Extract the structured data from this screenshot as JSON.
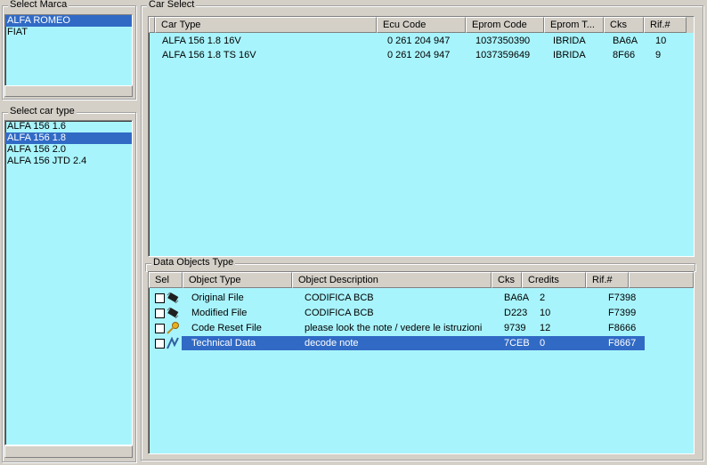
{
  "marca": {
    "title": "Select Marca",
    "items": [
      "ALFA ROMEO",
      "FIAT"
    ],
    "selected": 0
  },
  "cartype": {
    "title": "Select car type",
    "items": [
      "ALFA 156 1.6",
      "ALFA 156 1.8",
      "ALFA 156 2.0",
      "ALFA 156 JTD 2.4"
    ],
    "selected": 1
  },
  "carselect": {
    "title": "Car Select",
    "headers": [
      "Car Type",
      "Ecu Code",
      "Eprom Code",
      "Eprom T...",
      "Cks",
      "Rif.#"
    ],
    "rows": [
      [
        "ALFA 156 1.8 16V",
        "0 261 204 947",
        "1037350390",
        "IBRIDA",
        "BA6A",
        "10"
      ],
      [
        "ALFA 156 1.8 TS 16V",
        "0 261 204 947",
        "1037359649",
        "IBRIDA",
        "8F66",
        "9"
      ]
    ]
  },
  "objects": {
    "title": "Data Objects Type",
    "headers": [
      "Sel",
      "Object Type",
      "Object Description",
      "Cks",
      "Credits",
      "Rif.#"
    ],
    "rows": [
      {
        "icon": "chip-icon",
        "type": "Original File",
        "desc": "CODIFICA BCB",
        "cks": "BA6A",
        "credits": "2",
        "rif": "F7398"
      },
      {
        "icon": "chip-icon",
        "type": "Modified File",
        "desc": "CODIFICA BCB",
        "cks": "D223",
        "credits": "10",
        "rif": "F7399"
      },
      {
        "icon": "key-icon",
        "type": "Code Reset File",
        "desc": "please look the note / vedere le istruzioni",
        "cks": "9739",
        "credits": "12",
        "rif": "F8666"
      },
      {
        "icon": "wrench-icon",
        "type": "Technical Data",
        "desc": "decode note",
        "cks": "7CEB",
        "credits": "0",
        "rif": "F8667"
      }
    ],
    "selected": 3
  },
  "colors": {
    "list_bg": "#a8f4fc",
    "selection": "#316ac5"
  }
}
